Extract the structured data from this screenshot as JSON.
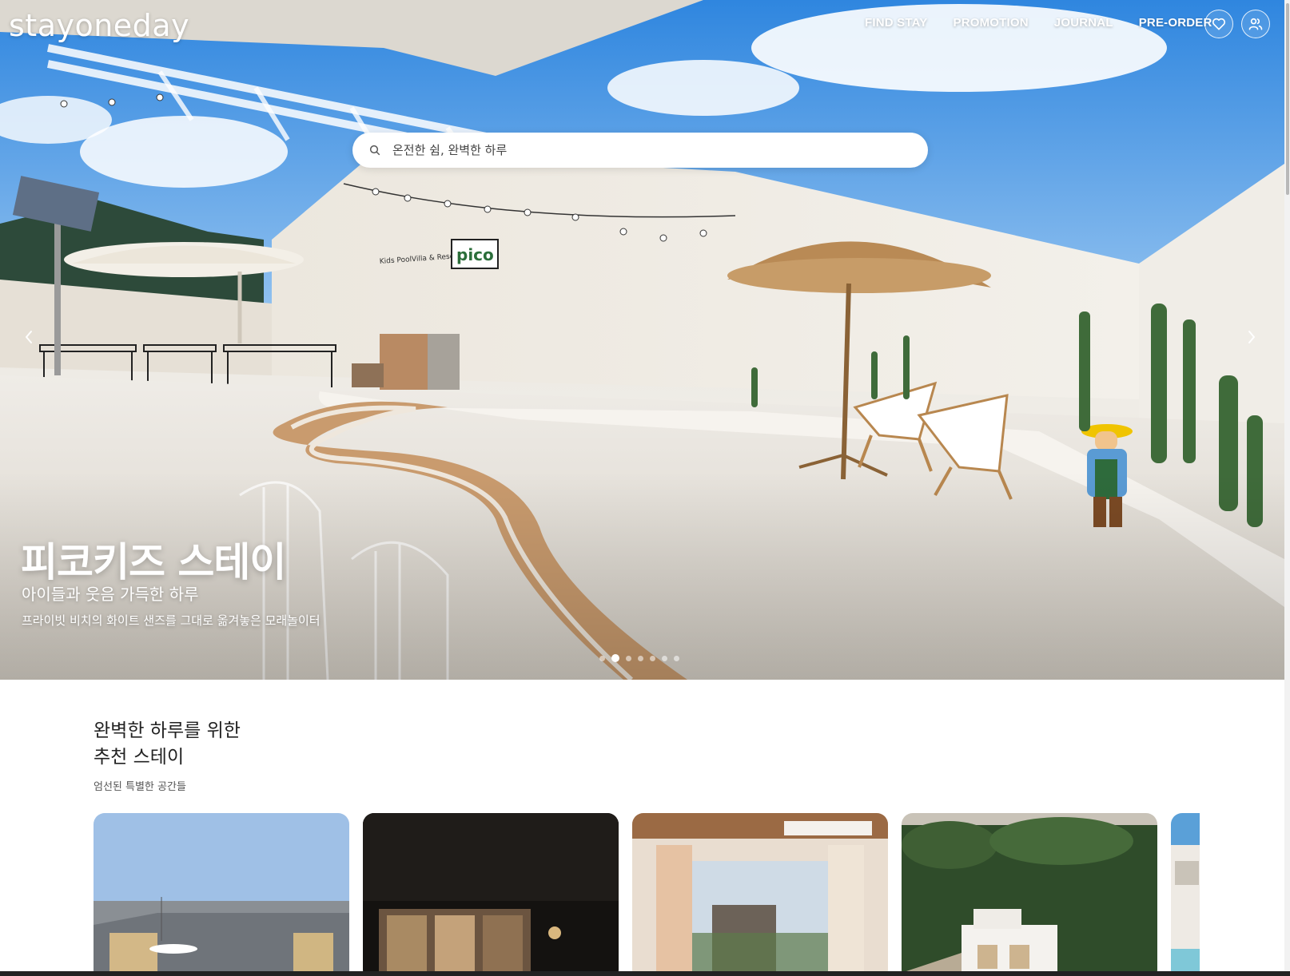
{
  "header": {
    "logo": "stayoneday",
    "nav": [
      "FIND STAY",
      "PROMOTION",
      "JOURNAL",
      "PRE-ORDER"
    ],
    "wishlist_icon": "heart-icon",
    "account_icon": "users-icon"
  },
  "search": {
    "placeholder": "온전한 쉼, 완벽한 하루",
    "icon": "search-icon"
  },
  "hero": {
    "title": "피코키즈 스테이",
    "subtitle": "아이들과 웃음 가득한 하루",
    "description": "프라이빗 비치의 화이트 샌즈를 그대로 옮겨놓은 모래놀이터",
    "sign_text": "Kids PoolVilla & Resort",
    "sign_logo": "pico",
    "slide_count": 7,
    "active_slide": 2,
    "prev_icon": "chevron-left-icon",
    "next_icon": "chevron-right-icon"
  },
  "recommend": {
    "title_line1": "완벽한 하루를 위한",
    "title_line2": "추천 스테이",
    "subtitle": "엄선된 특별한 공간들",
    "card_count": 5
  }
}
